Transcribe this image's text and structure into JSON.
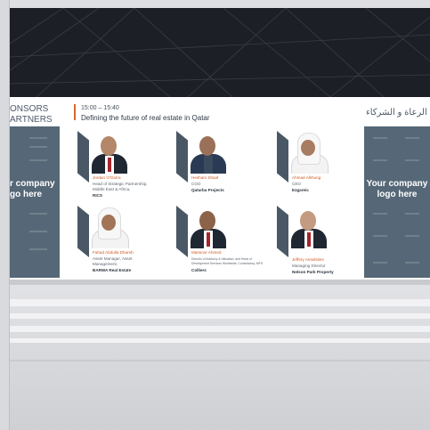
{
  "left_sponsors": {
    "title_line1": "ONSORS",
    "title_line2": "ARTNERS",
    "logo_line1": "r company",
    "logo_line2": "go here"
  },
  "right_sponsors": {
    "title": "الرعاة و الشركاء",
    "logo_line1": "Your company",
    "logo_line2": "logo here"
  },
  "session": {
    "time": "15:00 – 15:40",
    "title": "Defining the future of real estate in Qatar"
  },
  "speakers": [
    {
      "name": "Jordan O'Garra",
      "role_lines": [
        "Head of Strategic Partnership,",
        "Middle East & Africa,"
      ],
      "org": "RICS",
      "attire": "suit"
    },
    {
      "name": "Hesham Shaaf",
      "role_lines": [
        "COO"
      ],
      "org": "Qatarba Projects",
      "attire": "suit"
    },
    {
      "name": "Ahmad Alkhung",
      "role_lines": [
        "CEO"
      ],
      "org": "Ezgareic",
      "attire": "thobe"
    },
    {
      "name": "Fahad Abdulla Dhareb",
      "role_lines": [
        "Asset Manager, Asset",
        "Management,"
      ],
      "org": "BARWA Real Estate",
      "attire": "thobe"
    },
    {
      "name": "Mansoor Ahmed",
      "role_lines": [
        "Director of Advisory & Valuation, and Head of",
        "Development Services Worldwide, Consultancy, MFS"
      ],
      "org": "Colliers",
      "attire": "suit"
    },
    {
      "name": "Jeffery Anselstine",
      "role_lines": [
        "Managing Director"
      ],
      "org": "Nelson Park Property",
      "attire": "suit"
    }
  ],
  "colors": {
    "accent": "#d86a2c",
    "panel": "#566877",
    "ceiling": "#1d1f26"
  }
}
